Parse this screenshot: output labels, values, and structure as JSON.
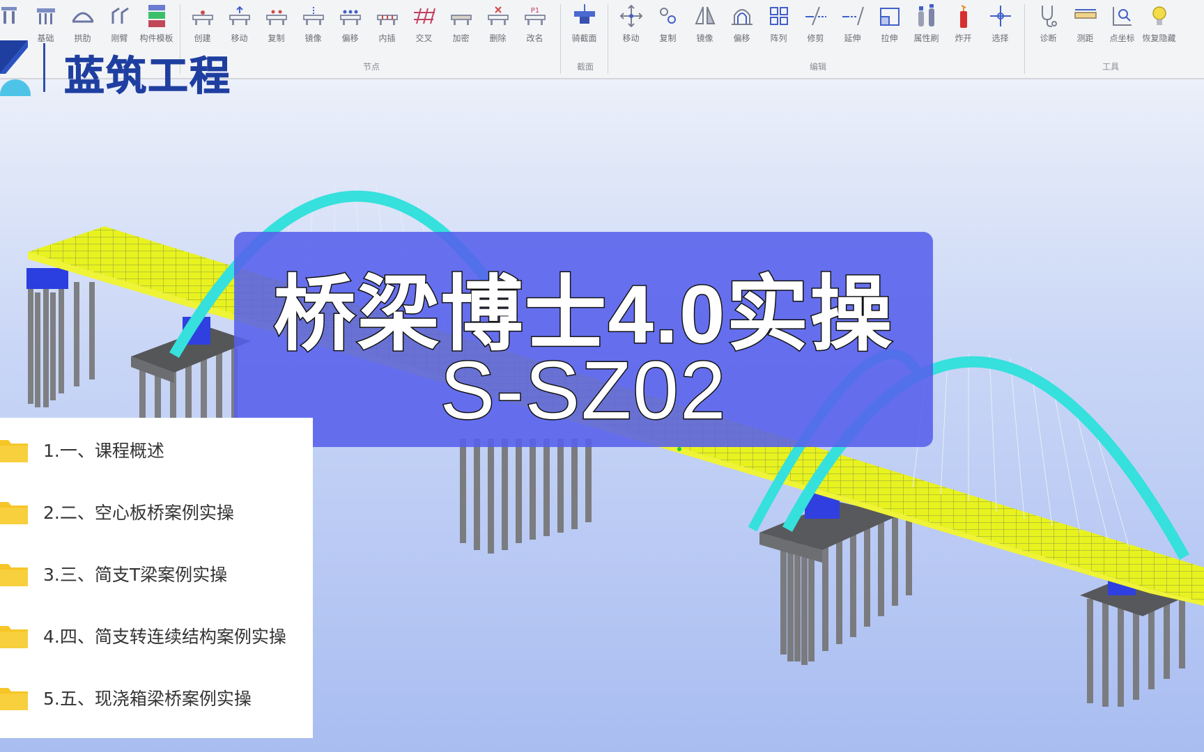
{
  "ribbon": {
    "groups": [
      {
        "label": "",
        "items": [
          {
            "label": "",
            "icon": "pier-icon"
          },
          {
            "label": "基础",
            "icon": "foundation-icon"
          },
          {
            "label": "拱肋",
            "icon": "arch-icon"
          },
          {
            "label": "刚臂",
            "icon": "rigid-arm-icon"
          },
          {
            "label": "构件模板",
            "icon": "component-template-icon"
          }
        ]
      },
      {
        "label": "节点",
        "items": [
          {
            "label": "创建",
            "icon": "node-create-icon"
          },
          {
            "label": "移动",
            "icon": "node-move-icon"
          },
          {
            "label": "复制",
            "icon": "node-copy-icon"
          },
          {
            "label": "镜像",
            "icon": "node-mirror-icon"
          },
          {
            "label": "偏移",
            "icon": "node-offset-icon"
          },
          {
            "label": "内插",
            "icon": "node-interpolate-icon"
          },
          {
            "label": "交叉",
            "icon": "node-cross-icon"
          },
          {
            "label": "加密",
            "icon": "node-densify-icon"
          },
          {
            "label": "删除",
            "icon": "node-delete-icon"
          },
          {
            "label": "改名",
            "icon": "node-rename-icon"
          }
        ]
      },
      {
        "label": "截面",
        "items": [
          {
            "label": "骑截面",
            "icon": "section-icon"
          }
        ]
      },
      {
        "label": "编辑",
        "items": [
          {
            "label": "移动",
            "icon": "move-icon"
          },
          {
            "label": "复制",
            "icon": "copy-icon"
          },
          {
            "label": "镜像",
            "icon": "mirror-icon"
          },
          {
            "label": "偏移",
            "icon": "offset-icon"
          },
          {
            "label": "阵列",
            "icon": "array-icon"
          },
          {
            "label": "修剪",
            "icon": "trim-icon"
          },
          {
            "label": "延伸",
            "icon": "extend-icon"
          },
          {
            "label": "拉伸",
            "icon": "stretch-icon"
          },
          {
            "label": "属性刷",
            "icon": "property-brush-icon"
          },
          {
            "label": "炸开",
            "icon": "explode-icon"
          },
          {
            "label": "选择",
            "icon": "select-icon"
          }
        ]
      },
      {
        "label": "工具",
        "items": [
          {
            "label": "诊断",
            "icon": "diagnose-icon"
          },
          {
            "label": "测距",
            "icon": "measure-icon"
          },
          {
            "label": "点坐标",
            "icon": "point-coordinate-icon"
          },
          {
            "label": "恢复隐藏",
            "icon": "restore-hidden-icon"
          }
        ]
      }
    ]
  },
  "logo": {
    "text": "蓝筑工程"
  },
  "title": {
    "line1": "桥梁博士4.0实操",
    "line2": "S-SZ02"
  },
  "folders": [
    "1.一、课程概述",
    "2.二、空心板桥案例实操",
    "3.三、简支T梁案例实操",
    "4.四、简支转连续结构案例实操",
    "5.五、现浇箱梁桥案例实操"
  ],
  "colors": {
    "accent": "#1f3fa0",
    "arch": "#33e6e0",
    "deck": "#e6f21a",
    "overlay": "#5660ec",
    "folder": "#f6c526"
  }
}
